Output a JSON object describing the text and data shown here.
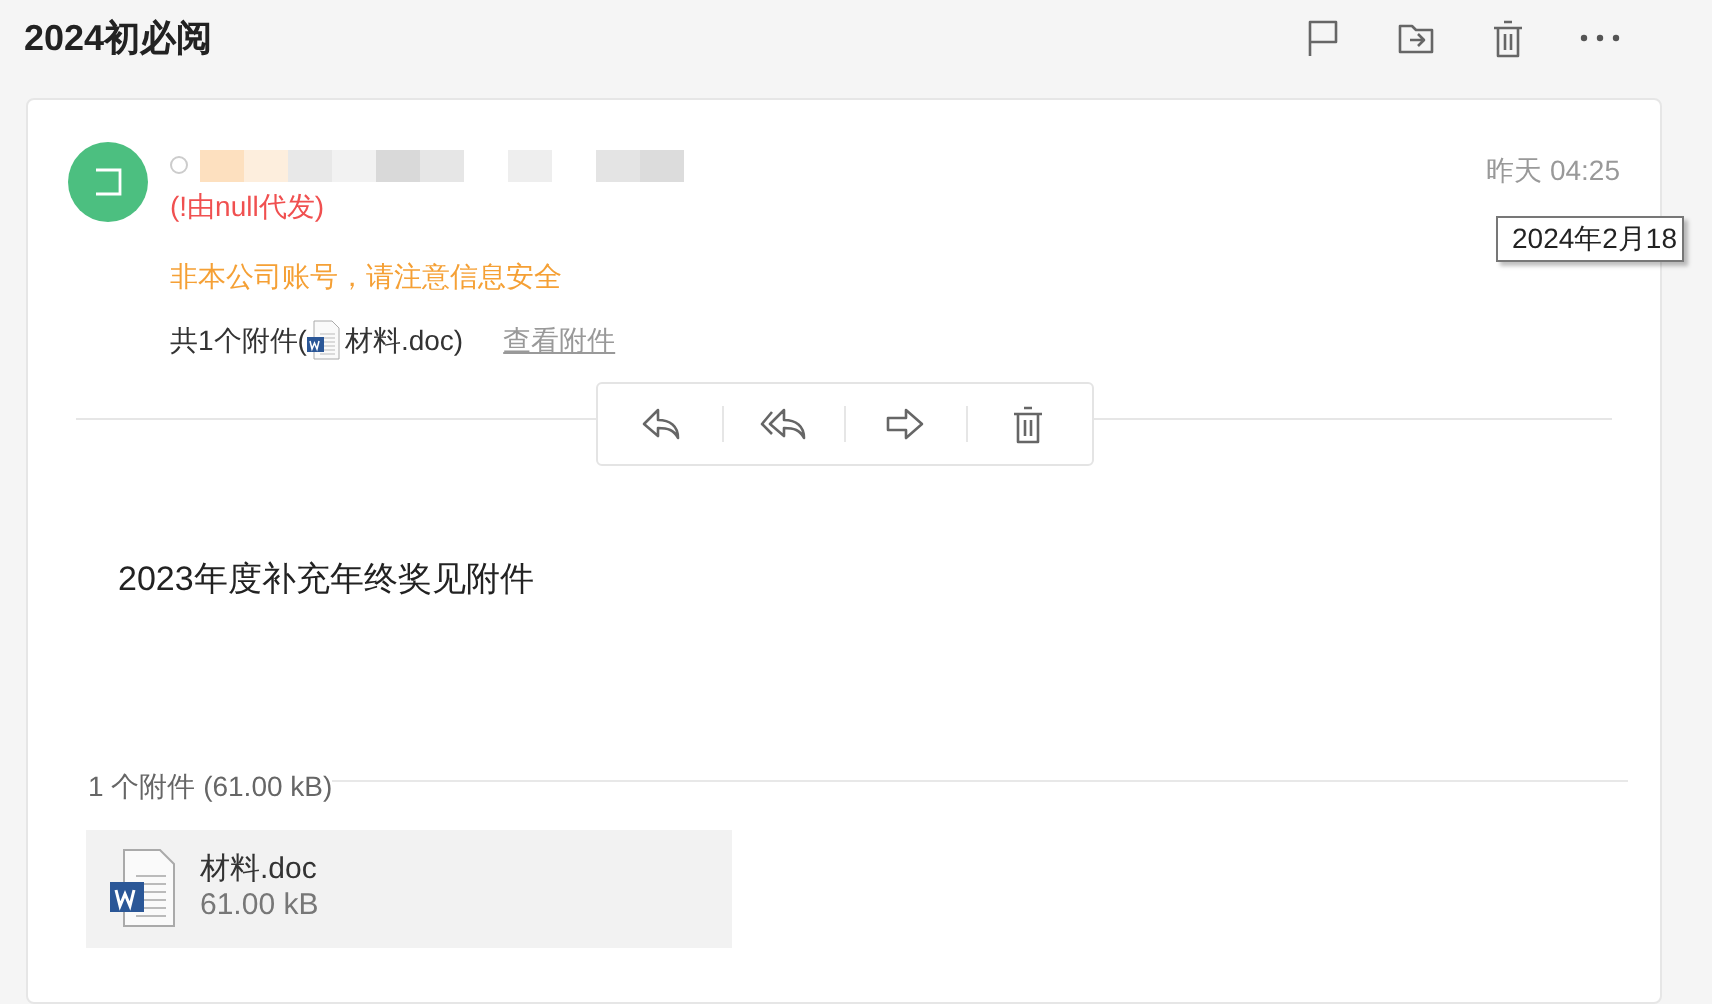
{
  "header": {
    "title": "2024初必阅",
    "actions": [
      {
        "kind": "flag"
      },
      {
        "kind": "move"
      },
      {
        "kind": "delete"
      },
      {
        "kind": "more"
      }
    ]
  },
  "message": {
    "time": "昨天 04:25",
    "tooltip": "2024年2月18",
    "proxy_note": "(!由null代发)",
    "warning": "非本公司账号，请注意信息安全",
    "attachment_summary": {
      "prefix": "共1个附件(",
      "file": "材料.doc",
      "suffix": ")",
      "link": "查看附件"
    },
    "toolbar": [
      {
        "kind": "reply"
      },
      {
        "kind": "reply_all"
      },
      {
        "kind": "forward"
      },
      {
        "kind": "delete"
      }
    ],
    "body": "2023年度补充年终奖见附件",
    "attachments_heading": "1 个附件 (61.00 kB)",
    "attachments": [
      {
        "name": "材料.doc",
        "size": "61.00 kB"
      }
    ]
  }
}
